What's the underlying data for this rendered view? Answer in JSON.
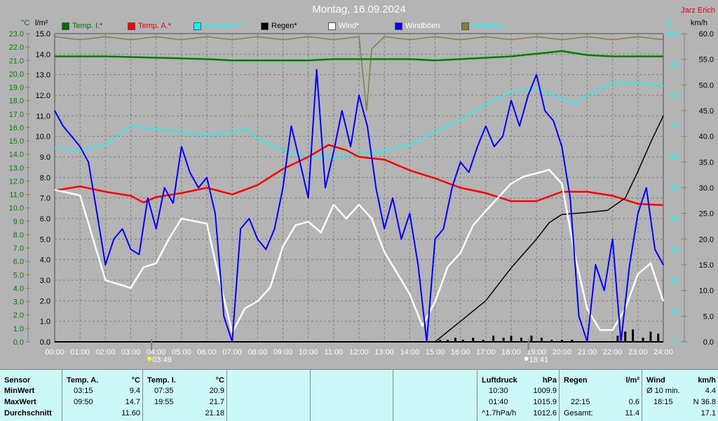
{
  "title": "Montag, 16.09.2024",
  "author": "Jarz Erich",
  "units": {
    "temp": "°C",
    "rain": "l/m²",
    "hum": "%",
    "wind": "km/h"
  },
  "legend": [
    {
      "label": "Temp. I.*",
      "color": "#007000",
      "text": "#007000"
    },
    {
      "label": "Temp. A.*",
      "color": "#ff0000",
      "text": "#e00000"
    },
    {
      "label": "Feuchte A.*",
      "color": "#00ffff",
      "text": "#00ffff"
    },
    {
      "label": "Regen*",
      "color": "#000000",
      "text": "#000000"
    },
    {
      "label": "Wind*",
      "color": "#ffffff",
      "text": "#ffffff"
    },
    {
      "label": "Windböen",
      "color": "#0000ff",
      "text": "#ffffff"
    },
    {
      "label": "Empfang",
      "color": "#808040",
      "text": "#00ffff"
    }
  ],
  "markers": [
    {
      "label": "03:49",
      "time": 3.82
    },
    {
      "label": "18:41",
      "time": 18.68
    }
  ],
  "chart_data": {
    "type": "line",
    "title": "Montag, 16.09.2024",
    "x_ticks": [
      "00:00",
      "01:00",
      "02:00",
      "03:00",
      "04:00",
      "05:00",
      "06:00",
      "07:00",
      "08:00",
      "09:00",
      "10:00",
      "11:00",
      "12:00",
      "13:00",
      "14:00",
      "15:00",
      "16:00",
      "17:00",
      "18:00",
      "19:00",
      "20:00",
      "21:00",
      "22:00",
      "23:00",
      "24:00"
    ],
    "axes": {
      "temp": {
        "range": [
          0,
          23
        ],
        "ticks": [
          "0.0",
          "1.0",
          "2.0",
          "3.0",
          "4.0",
          "5.0",
          "6.0",
          "7.0",
          "8.0",
          "9.0",
          "10.0",
          "11.0",
          "12.0",
          "13.0",
          "14.0",
          "15.0",
          "16.0",
          "17.0",
          "18.0",
          "19.0",
          "20.0",
          "21.0",
          "22.0",
          "23.0"
        ]
      },
      "rain": {
        "range": [
          0,
          15
        ],
        "ticks": [
          "0.0",
          "1.0",
          "2.0",
          "3.0",
          "4.0",
          "5.0",
          "6.0",
          "7.0",
          "8.0",
          "9.0",
          "10.0",
          "11.0",
          "12.0",
          "13.0",
          "14.0",
          "15.0"
        ]
      },
      "hum": {
        "range": [
          0,
          100
        ],
        "ticks": [
          "0",
          "10",
          "20",
          "30",
          "40",
          "50",
          "60",
          "70",
          "80",
          "90",
          "100"
        ]
      },
      "wind": {
        "range": [
          0,
          60
        ],
        "ticks": [
          "0.0",
          "5.0",
          "10.0",
          "15.0",
          "20.0",
          "25.0",
          "30.0",
          "35.0",
          "40.0",
          "45.0",
          "50.0",
          "55.0",
          "60.0"
        ]
      }
    },
    "series": [
      {
        "name": "Empfang",
        "axis": "hum",
        "color": "#808040",
        "x": [
          0,
          1,
          2,
          3,
          4,
          5,
          6,
          7,
          8,
          9,
          10,
          11,
          12,
          12.3,
          12.5,
          13,
          14,
          15,
          16,
          17,
          18,
          19,
          20,
          21,
          22,
          23,
          24
        ],
        "y": [
          99,
          98,
          99,
          98,
          99,
          98,
          99,
          98,
          99,
          98,
          99,
          98,
          99,
          75,
          95,
          99,
          98,
          99,
          98,
          99,
          98,
          99,
          98,
          99,
          98,
          99,
          98
        ]
      },
      {
        "name": "Temp. I.",
        "axis": "temp",
        "color": "#008000",
        "x": [
          0,
          2,
          4,
          6,
          7,
          8,
          10,
          11,
          12,
          13,
          14,
          15,
          16,
          18,
          19,
          20,
          21,
          22,
          24
        ],
        "y": [
          21.3,
          21.3,
          21.2,
          21.1,
          21.0,
          21.0,
          21.0,
          21.1,
          21.1,
          21.1,
          21.1,
          21.0,
          21.1,
          21.3,
          21.5,
          21.7,
          21.4,
          21.3,
          21.3
        ]
      },
      {
        "name": "Feuchte A.",
        "axis": "hum",
        "color": "#00ffff",
        "x": [
          0,
          1,
          2,
          3,
          4,
          5,
          6,
          7,
          7.5,
          8,
          9,
          10,
          11,
          12,
          13,
          14,
          15,
          16,
          17,
          18,
          19,
          20,
          20.5,
          21,
          22,
          23,
          24
        ],
        "y": [
          63,
          62,
          64,
          70,
          69,
          68,
          67,
          68,
          69,
          66,
          62,
          60,
          60,
          61,
          62,
          64,
          68,
          72,
          77,
          81,
          82,
          79,
          77,
          80,
          84,
          84,
          83
        ]
      },
      {
        "name": "Temp. A.",
        "axis": "temp",
        "color": "#ff0000",
        "x": [
          0,
          1,
          2,
          3,
          3.5,
          4,
          5,
          6,
          7,
          8,
          9,
          10,
          10.8,
          11.5,
          12,
          13,
          14,
          15,
          16,
          17,
          18,
          19,
          20,
          21,
          22,
          23,
          24
        ],
        "y": [
          11.3,
          11.6,
          11.2,
          10.9,
          10.4,
          10.8,
          11.1,
          11.5,
          11.0,
          11.7,
          12.9,
          13.8,
          14.7,
          14.3,
          13.8,
          13.6,
          12.8,
          12.2,
          11.5,
          11.1,
          10.5,
          10.5,
          11.2,
          11.2,
          10.9,
          10.3,
          10.2
        ]
      },
      {
        "name": "Regen",
        "axis": "rain",
        "color": "#000000",
        "x": [
          0,
          15,
          16,
          17,
          18,
          19,
          19.5,
          20,
          21,
          21.8,
          22.5,
          23,
          23.5,
          24
        ],
        "y": [
          0,
          0,
          1.0,
          2.0,
          3.6,
          5.0,
          5.8,
          6.2,
          6.3,
          6.4,
          7.0,
          8.3,
          9.7,
          11.0
        ]
      },
      {
        "name": "Wind",
        "axis": "wind",
        "color": "#ffffff",
        "x": [
          0,
          1,
          2,
          3,
          3.5,
          4,
          4.5,
          5,
          6,
          6.5,
          7,
          7.5,
          8,
          8.5,
          9,
          9.5,
          10,
          10.5,
          11,
          11.5,
          12,
          12.5,
          13,
          14,
          14.5,
          15,
          15.5,
          16,
          16.5,
          17,
          18,
          18.5,
          19,
          19.5,
          20,
          20.5,
          21,
          21.5,
          22,
          22.5,
          23,
          23.5,
          24
        ],
        "y": [
          29.6,
          28.5,
          12,
          10.5,
          14.5,
          15.3,
          20,
          24,
          23,
          12,
          1.8,
          6.5,
          7.9,
          10.6,
          18.6,
          22.7,
          23.4,
          21.3,
          26.7,
          24,
          26.7,
          24,
          17.5,
          9.3,
          3.1,
          7.8,
          14.6,
          17.3,
          22.7,
          25.5,
          30.8,
          32.2,
          32.8,
          33.5,
          30.8,
          17.2,
          6.4,
          2.3,
          2.3,
          6.5,
          13.2,
          15.3,
          7.9
        ]
      },
      {
        "name": "Windböen",
        "axis": "wind",
        "color": "#0000ff",
        "x": [
          0,
          0.33,
          0.67,
          1,
          1.33,
          1.67,
          2,
          2.33,
          2.67,
          3,
          3.33,
          3.67,
          4,
          4.33,
          4.67,
          5,
          5.33,
          5.67,
          6,
          6.33,
          6.67,
          7,
          7.33,
          7.67,
          8,
          8.33,
          8.67,
          9,
          9.33,
          9.67,
          10,
          10.33,
          10.67,
          11,
          11.33,
          11.67,
          12,
          12.33,
          12.67,
          13,
          13.33,
          13.67,
          14,
          14.33,
          14.67,
          15,
          15.33,
          15.67,
          16,
          16.33,
          16.67,
          17,
          17.33,
          17.67,
          18,
          18.33,
          18.67,
          19,
          19.33,
          19.67,
          20,
          20.33,
          20.67,
          21,
          21.33,
          21.67,
          22,
          22.33,
          22.67,
          23,
          23.33,
          23.67,
          24
        ],
        "y": [
          45,
          42,
          40,
          38,
          35,
          25,
          15,
          20,
          22,
          18,
          17,
          28,
          22,
          30,
          27,
          38,
          33,
          30,
          32,
          25,
          5,
          0,
          22,
          24,
          20,
          18,
          22,
          30,
          42,
          35,
          28,
          53,
          30,
          37,
          45,
          38,
          48,
          42,
          30,
          22,
          28,
          20,
          25,
          15,
          0,
          20,
          22,
          30,
          35,
          33,
          38,
          42,
          38,
          40,
          47,
          42,
          48,
          52,
          45,
          43,
          38,
          28,
          5,
          0,
          15,
          10,
          20,
          0,
          15,
          25,
          30,
          18,
          15
        ]
      }
    ],
    "rain_bars": {
      "x": [
        15.2,
        15.5,
        15.8,
        16.1,
        16.5,
        16.9,
        17.3,
        17.7,
        18.0,
        18.4,
        18.8,
        19.2,
        19.6,
        20.0,
        20.4,
        22.2,
        22.5,
        22.8,
        23.2,
        23.5,
        23.8
      ],
      "y": [
        0.1,
        0.1,
        0.2,
        0.1,
        0.2,
        0.1,
        0.3,
        0.2,
        0.3,
        0.2,
        0.3,
        0.2,
        0.1,
        0.1,
        0.1,
        0.3,
        0.5,
        0.6,
        0.2,
        0.5,
        0.4
      ]
    }
  },
  "table": {
    "cols": [
      {
        "rows": [
          [
            "Sensor",
            ""
          ],
          [
            "MinWert",
            ""
          ],
          [
            "MaxWert",
            ""
          ],
          [
            "Durchschnitt",
            ""
          ]
        ]
      },
      {
        "rows": [
          [
            "Temp. A.",
            "°C"
          ],
          [
            "03:15",
            "9.4"
          ],
          [
            "09:50",
            "14.7"
          ],
          [
            "",
            "11.60"
          ]
        ]
      },
      {
        "rows": [
          [
            "Temp. I.",
            "°C"
          ],
          [
            "07:35",
            "20.9"
          ],
          [
            "19:55",
            "21.7"
          ],
          [
            "",
            "21.18"
          ]
        ]
      },
      {
        "rows": []
      },
      {
        "rows": []
      },
      {
        "rows": []
      },
      {
        "rows": [
          [
            "Luftdruck",
            "hPa"
          ],
          [
            "10:30",
            "1009.9"
          ],
          [
            "01:40",
            "1015.9"
          ],
          [
            "^1.7hPa/h",
            "1012.6"
          ]
        ]
      },
      {
        "rows": [
          [
            "Regen",
            "l/m²"
          ],
          [
            "",
            ""
          ],
          [
            "22:15",
            "0.6"
          ],
          [
            "Gesamt:",
            "11.4"
          ]
        ]
      },
      {
        "rows": [
          [
            "Wind",
            "km/h"
          ],
          [
            "Ø 10 min.",
            "4.4"
          ],
          [
            "18:15",
            "N 36.8"
          ],
          [
            "",
            "17.1"
          ]
        ]
      }
    ]
  }
}
